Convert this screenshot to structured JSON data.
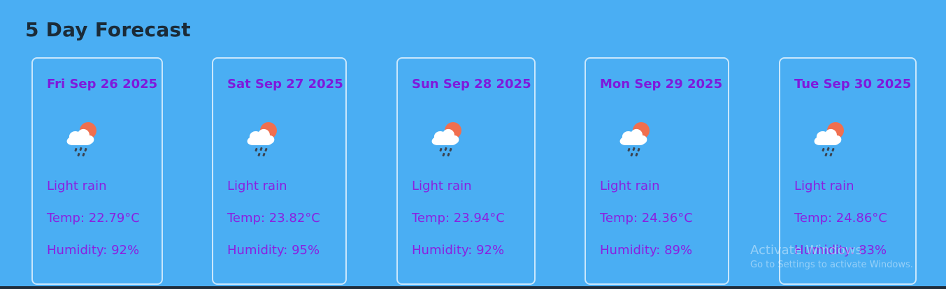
{
  "page": {
    "title": "5 Day Forecast"
  },
  "forecast": [
    {
      "date": "Fri Sep 26 2025",
      "icon": "cloud-rain-sun-icon",
      "description": "Light rain",
      "temp": "Temp: 22.79°C",
      "humidity": "Humidity: 92%"
    },
    {
      "date": "Sat Sep 27 2025",
      "icon": "cloud-rain-sun-icon",
      "description": "Light rain",
      "temp": "Temp: 23.82°C",
      "humidity": "Humidity: 95%"
    },
    {
      "date": "Sun Sep 28 2025",
      "icon": "cloud-rain-sun-icon",
      "description": "Light rain",
      "temp": "Temp: 23.94°C",
      "humidity": "Humidity: 92%"
    },
    {
      "date": "Mon Sep 29 2025",
      "icon": "cloud-rain-sun-icon",
      "description": "Light rain",
      "temp": "Temp: 24.36°C",
      "humidity": "Humidity: 89%"
    },
    {
      "date": "Tue Sep 30 2025",
      "icon": "cloud-rain-sun-icon",
      "description": "Light rain",
      "temp": "Temp: 24.86°C",
      "humidity": "Humidity: 83%"
    }
  ],
  "watermark": {
    "title": "Activate Windows",
    "subtitle": "Go to Settings to activate Windows."
  },
  "colors": {
    "background": "#4aaef3",
    "title": "#1b2b38",
    "card_text": "#8a21e0",
    "card_border": "#e6f3ff",
    "sun": "#f06f4f",
    "cloud": "#ffffff",
    "rain": "#3a4350"
  }
}
